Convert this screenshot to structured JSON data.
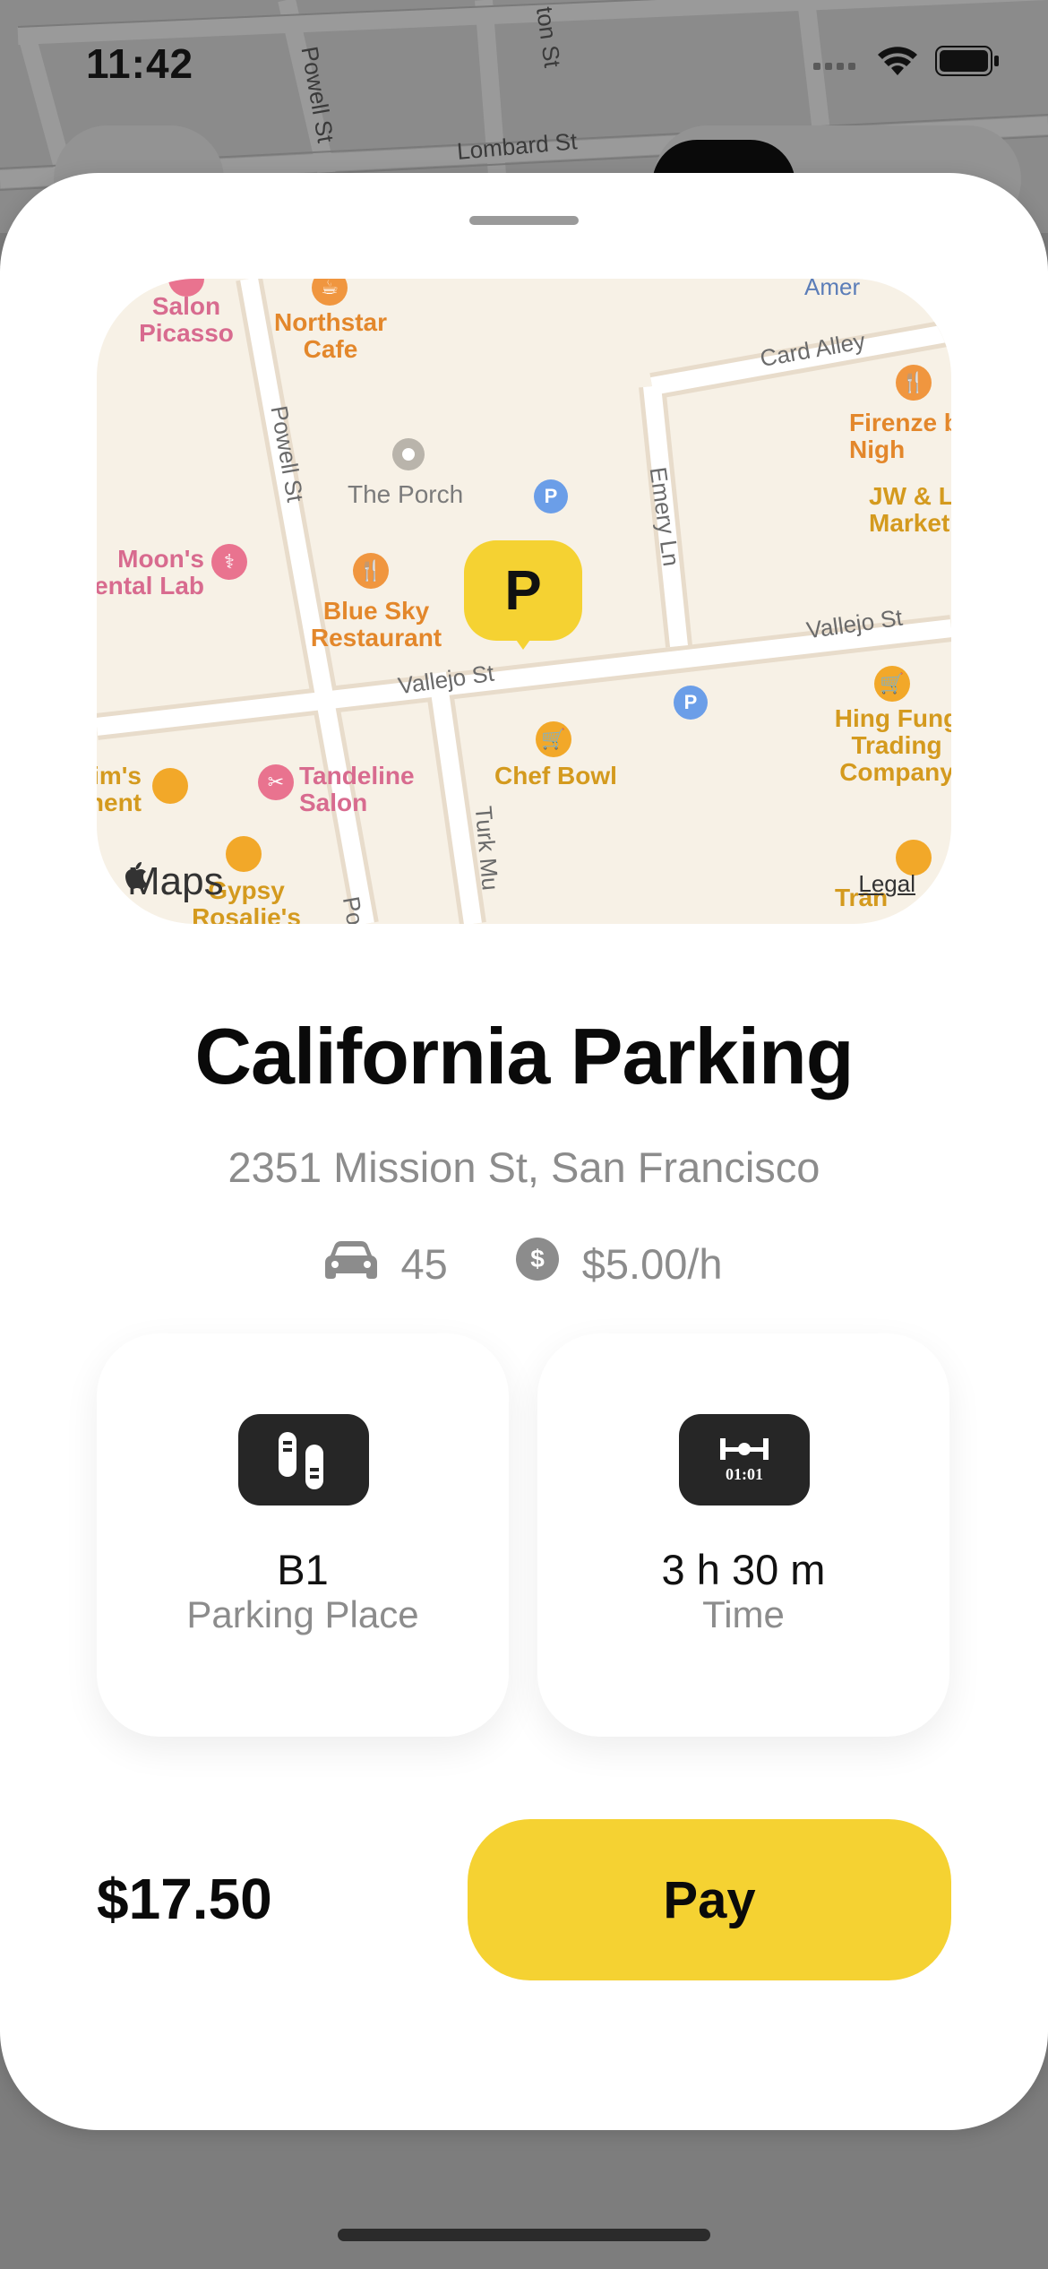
{
  "status_bar": {
    "time": "11:42"
  },
  "background_map": {
    "streets": [
      "Powell St",
      "Lombard St",
      "ton St"
    ]
  },
  "map": {
    "pin_label": "P",
    "attribution": "Maps",
    "legal": "Legal",
    "streets": [
      "Card Alley",
      "Powell St",
      "Emery Ln",
      "Vallejo St",
      "Vallejo St",
      "Turk Mu",
      "Po",
      "Amer"
    ],
    "pois": [
      "Salon Picasso",
      "Northstar Cafe",
      "The Porch",
      "Moon's ental Lab",
      "Blue Sky Restaurant",
      "Firenze by Nigh",
      "JW & L Market",
      "Tandeline Salon",
      "Chef Bowl",
      "Hing Fung Trading Company",
      "im's nent",
      "Gypsy Rosalie's",
      "Tran"
    ],
    "poi_icon_letter": "P"
  },
  "place": {
    "title": "California Parking",
    "address": "2351 Mission St, San Francisco",
    "spots": "45",
    "rate": "$5.00/h"
  },
  "cards": {
    "parking_place": {
      "value": "B1",
      "label": "Parking Place"
    },
    "time": {
      "value": "3 h 30 m",
      "label": "Time",
      "icon_text": "01:01"
    }
  },
  "total": "$17.50",
  "pay_label": "Pay",
  "colors": {
    "accent": "#f5d232",
    "text_primary": "#0a0a0a",
    "text_secondary": "#8c8c8c",
    "card_icon_bg": "#262626"
  }
}
